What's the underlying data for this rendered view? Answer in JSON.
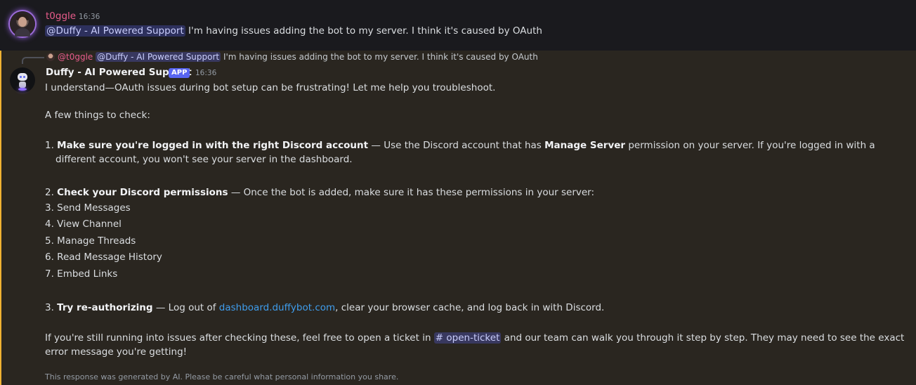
{
  "message1": {
    "author": "t0ggle",
    "time": "16:36",
    "mention": "@Duffy - AI Powered Support",
    "text": " I'm having issues adding the bot to my server. I think it's caused by OAuth"
  },
  "message2": {
    "reply": {
      "author": "@t0ggle",
      "mention": "@Duffy - AI Powered Support",
      "text": " I'm having issues adding the bot to my server. I think it's caused by OAuth"
    },
    "author": "Duffy - AI Powered Support",
    "badge": "APP",
    "time": "16:36",
    "intro": "I understand—OAuth issues during bot setup can be frustrating! Let me help you troubleshoot.",
    "checks_heading": "A few things to check:",
    "item1": {
      "num": "1. ",
      "bold": "Make sure you're logged in with the right Discord account",
      "text_a": " — Use the Discord account that has ",
      "bold2": "Manage Server",
      "text_b": " permission on your server. If you're logged in with a different account, you won't see your server in the dashboard."
    },
    "item2": {
      "num": "2. ",
      "bold": "Check your Discord permissions",
      "text": " — Once the bot is added, make sure it has these permissions in your server:"
    },
    "permissions": [
      "3. Send Messages",
      "4. View Channel",
      "5. Manage Threads",
      "6. Read Message History",
      "7. Embed Links"
    ],
    "item3": {
      "num": "3. ",
      "bold": "Try re-authorizing",
      "text_a": " — Log out of ",
      "link": "dashboard.duffybot.com",
      "text_b": ", clear your browser cache, and log back in with Discord."
    },
    "closing": {
      "text_a": "If you're still running into issues after checking these, feel free to open a ticket in ",
      "channel": "# open-ticket",
      "text_b": " and our team can walk you through it step by step. They may need to see the exact error message you're getting!"
    },
    "disclaimer": "This response was generated by AI. Please be careful what personal information you share."
  },
  "colors": {
    "username_t0ggle": "#e85c8b",
    "accent_bar": "#f0b232",
    "mention_bg": "#5865f2",
    "link": "#3f9ded"
  }
}
